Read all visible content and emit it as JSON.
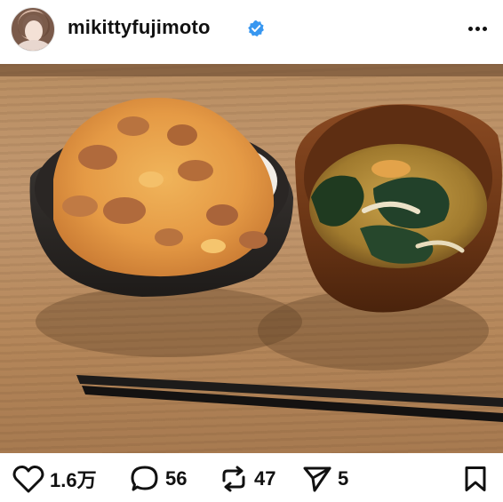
{
  "header": {
    "username": "mikittyfujimoto",
    "verified": true,
    "avatar_icon": "profile-avatar",
    "more_icon": "more-horizontal-icon"
  },
  "post": {
    "image_icon": "food-photo-donburi-and-miso-soup"
  },
  "actions": {
    "likes": "1.6万",
    "comments": "56",
    "reposts": "47",
    "shares": "5"
  },
  "colors": {
    "verified_blue": "#3897f0",
    "text": "#111111"
  }
}
